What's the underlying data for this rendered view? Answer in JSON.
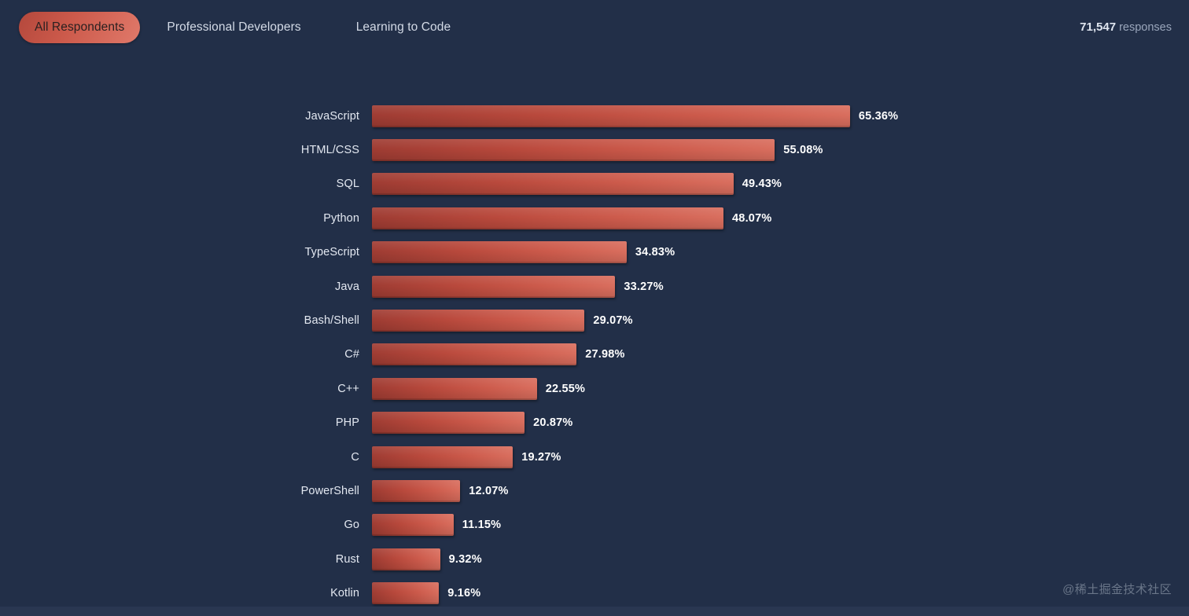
{
  "tabs": [
    {
      "label": "All Respondents",
      "active": true
    },
    {
      "label": "Professional Developers",
      "active": false
    },
    {
      "label": "Learning to Code",
      "active": false
    }
  ],
  "responses": {
    "count": "71,547",
    "label": "responses"
  },
  "watermark": "@稀土掘金技术社区",
  "colors": {
    "background": "#222f48",
    "bar_start": "#9f3c33",
    "bar_end": "#d96e5e",
    "accent": "#cc5a4b",
    "tab_inactive_text": "#d3dae6",
    "value_text": "#ffffff"
  },
  "chart_data": {
    "type": "bar",
    "orientation": "horizontal",
    "title": "",
    "xlabel": "",
    "ylabel": "",
    "xlim": [
      0,
      70
    ],
    "grid": false,
    "legend": false,
    "value_suffix": "%",
    "categories": [
      "JavaScript",
      "HTML/CSS",
      "SQL",
      "Python",
      "TypeScript",
      "Java",
      "Bash/Shell",
      "C#",
      "C++",
      "PHP",
      "C",
      "PowerShell",
      "Go",
      "Rust",
      "Kotlin"
    ],
    "values": [
      65.36,
      55.08,
      49.43,
      48.07,
      34.83,
      33.27,
      29.07,
      27.98,
      22.55,
      20.87,
      19.27,
      12.07,
      11.15,
      9.32,
      9.16
    ],
    "labels": [
      "65.36%",
      "55.08%",
      "49.43%",
      "48.07%",
      "34.83%",
      "33.27%",
      "29.07%",
      "27.98%",
      "22.55%",
      "20.87%",
      "19.27%",
      "12.07%",
      "11.15%",
      "9.32%",
      "9.16%"
    ]
  }
}
